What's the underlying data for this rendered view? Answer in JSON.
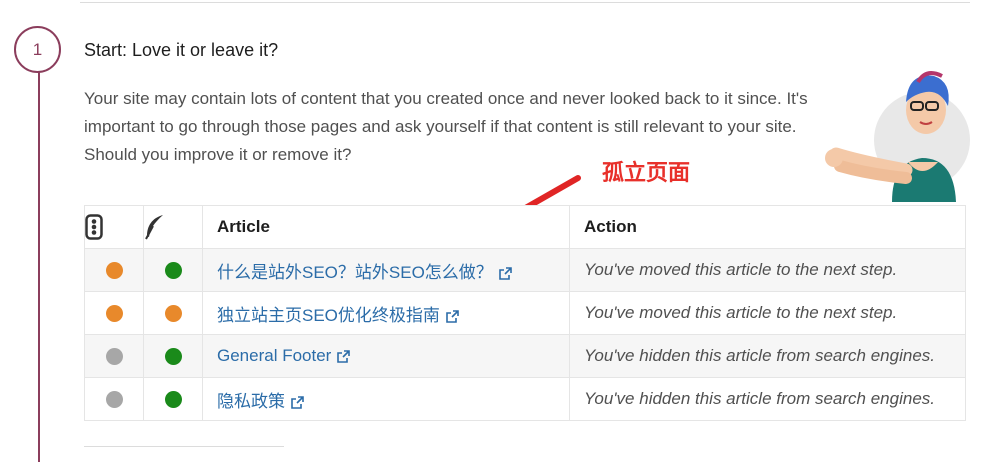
{
  "step": {
    "number": "1",
    "title": "Start: Love it or leave it?",
    "description": "Your site may contain lots of content that you created once and never looked back to it since. It's important to go through those pages and ask yourself if that content is still relevant to your site. Should you improve it or remove it?"
  },
  "annotation": {
    "label": "孤立页面",
    "color": "#e8302a"
  },
  "table": {
    "header_icons": [
      "traffic-light-icon",
      "feather-icon"
    ],
    "headers": {
      "article": "Article",
      "action": "Action"
    },
    "rows": [
      {
        "seo_status": "orange",
        "readability_status": "green",
        "article": "什么是站外SEO？站外SEO怎么做？",
        "action": "You've moved this article to the next step."
      },
      {
        "seo_status": "orange",
        "readability_status": "orange",
        "article": "独立站主页SEO优化终极指南",
        "action": "You've moved this article to the next step."
      },
      {
        "seo_status": "gray",
        "readability_status": "green",
        "article": "General Footer",
        "action": "You've hidden this article from search engines."
      },
      {
        "seo_status": "gray",
        "readability_status": "green",
        "article": "隐私政策",
        "action": "You've hidden this article from search engines."
      }
    ]
  },
  "colors": {
    "accent": "#8b3d5c",
    "link": "#2b6ca8",
    "orange": "#e8892b",
    "green": "#1a8a1a",
    "gray": "#a7a7a7"
  }
}
